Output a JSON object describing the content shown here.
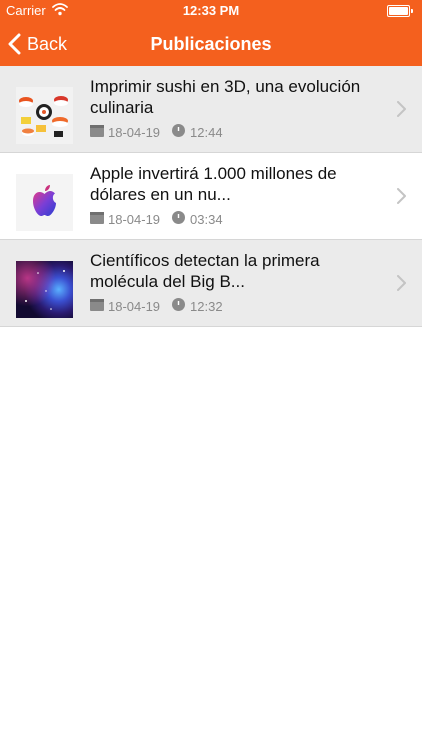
{
  "status_bar": {
    "carrier": "Carrier",
    "time": "12:33 PM",
    "wifi_icon": "wifi-icon",
    "battery_icon": "battery-icon"
  },
  "nav": {
    "back_label": "Back",
    "title": "Publicaciones",
    "accent_color": "#f4601e"
  },
  "posts": [
    {
      "title": "Imprimir sushi en 3D, una evolución culinaria",
      "date": "18-04-19",
      "time": "12:44",
      "thumbnail": "sushi-thumbnail"
    },
    {
      "title": "Apple invertirá 1.000 millones de dólares en un nu...",
      "date": "18-04-19",
      "time": "03:34",
      "thumbnail": "apple-logo-thumbnail"
    },
    {
      "title": "Científicos detectan la primera molécula del Big B...",
      "date": "18-04-19",
      "time": "12:32",
      "thumbnail": "space-nebula-thumbnail"
    }
  ]
}
